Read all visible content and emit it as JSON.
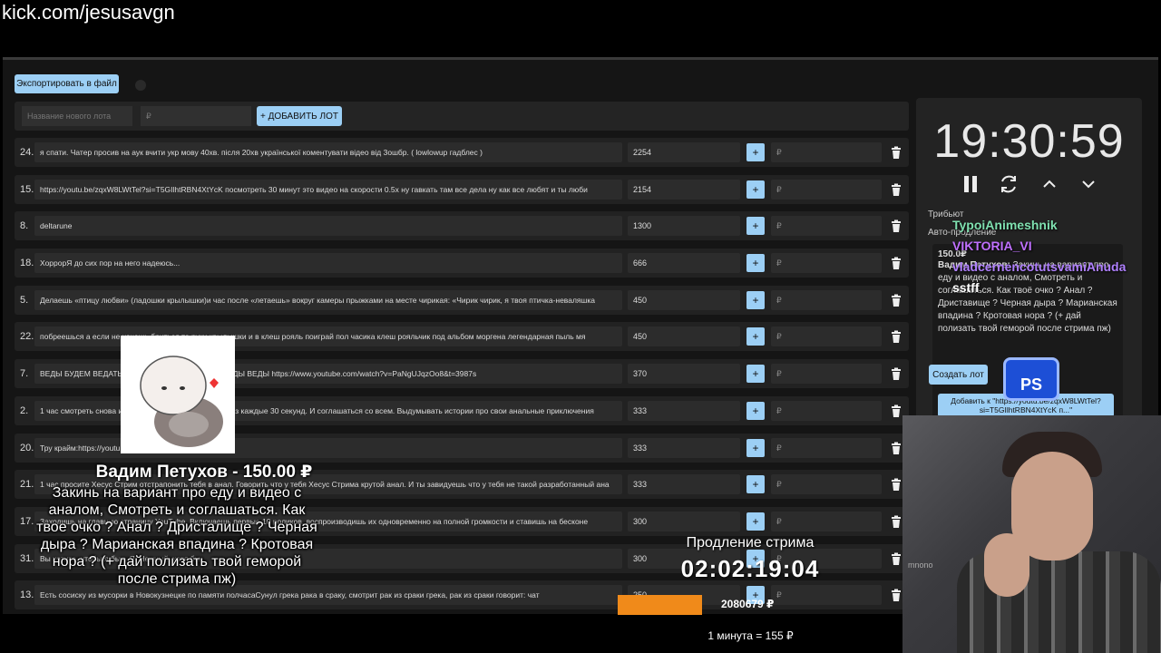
{
  "browser": {
    "url": "kick.com/jesusavgn"
  },
  "toolbar": {
    "export_label": "Экспортировать в файл"
  },
  "new_lot": {
    "name_placeholder": "Название нового лота",
    "price_placeholder": "₽",
    "add_label": "+ ДОБАВИТЬ ЛОТ"
  },
  "lots": [
    {
      "num": "24.",
      "title": "я спати. Чатер просив на аук вчити укр мову 40хв. після 20хв української коментувати відео від 3oшбр. ( lowlowup гадблес )",
      "amount": "2254",
      "add_placeholder": "₽"
    },
    {
      "num": "15.",
      "title": "https://youtu.be/zqxW8LWtTel?si=T5GIlhtRBN4XtYcK посмотреть 30 минут это видео на скорости 0.5x ну гавкать там все дела ну как все любят и ты люби",
      "amount": "2154",
      "add_placeholder": "₽"
    },
    {
      "num": "8.",
      "title": "deltarune",
      "amount": "1300",
      "add_placeholder": "₽"
    },
    {
      "num": "18.",
      "title": "ХоррорЯ до сих пор на него надеюсь...",
      "amount": "666",
      "add_placeholder": "₽"
    },
    {
      "num": "5.",
      "title": "Делаешь «птицу любви» (ладошки крылышки)и час после «летаешь» вокруг камеры прыжками на месте чирикая: «Чирик чирик, я твоя птичка-неваляшка",
      "amount": "450",
      "add_placeholder": "₽"
    },
    {
      "num": "22.",
      "title": "побреешься а если не хочешь бриться то руки крылышки и в клеш рояль поиграй пол часика клеш рояльчик под альбом моргена легендарная пыль мя",
      "amount": "450",
      "add_placeholder": "₽"
    },
    {
      "num": "7.",
      "title": "ВЕДЫ БУДЕМ ВЕДАТЬ ВЕДЫ ВЕДЫ ВЕДЫ ВЕДЫ ВЕДЫ ВЕДЫ https://www.youtube.com/watch?v=PaNgUJqzOo8&t=3987s",
      "amount": "370",
      "add_placeholder": "₽"
    },
    {
      "num": "2.",
      "title": "1 час смотреть снова и снова одно и то же видео через каждые 30 секунд. И соглашаться со всем. Выдумывать истории про свои анальные приключения",
      "amount": "333",
      "add_placeholder": "₽"
    },
    {
      "num": "20.",
      "title": "Тру крайм:https://youtu.be/3lpdC-RCiT",
      "amount": "333",
      "add_placeholder": "₽"
    },
    {
      "num": "21.",
      "title": "1 час просите Хесус Стрим отстрапонить тебя в анал. Говорить что у тебя Хесус Стрима крутой анал. И ты завидуешь что у тебя не такой разработанный ана",
      "amount": "333",
      "add_placeholder": "₽"
    },
    {
      "num": "17.",
      "title": "Заходишь на главную страницу YouTube. Включаешь первые 10 роликов, воспроизводишь их одновременно на полной громкости и ставишь на бесконе",
      "amount": "300",
      "add_placeholder": "₽"
    },
    {
      "num": "31.",
      "title": "Вы хотите, чтобы я был. Я, Нежный, хотя бы",
      "amount": "300",
      "add_placeholder": "₽"
    },
    {
      "num": "13.",
      "title": "Есть сосиску из мусорки в Новокузнецке по памяти полчасаСунул грека рака в сраку, смотрит рак из сраки грека, рак из сраки говорит: чат",
      "amount": "250",
      "add_placeholder": "₽"
    }
  ],
  "timer": {
    "display": "19:30:59"
  },
  "panel": {
    "tribute_label": "Трибьют",
    "autoext_label": "Авто-продление",
    "donation_amount": "150.0₽",
    "donation_author": "Вадим Петухов:",
    "donation_text": "Закинь на вариант про еду и видео с аналом, Смотреть и соглашаться. Как твоё очко ? Анал ? Дриставище ? Черная дыра ? Марианская впадина ? Кротовая нора ? (+ дай полизать твой геморой после стрима пж)",
    "create_lot_label": "Создать лот",
    "add_to_label": "Добавить к \"https://youtu.be/zqxW8LWtTel?si=T5GIlhtRBN4XtYcK п...\""
  },
  "chat": [
    {
      "name": "TypoiAnimeshnik",
      "color": "#7fe0b0"
    },
    {
      "name": "VIKTORIA_VI",
      "color": "#c070ff"
    },
    {
      "name": "vladcernencotutsvamiAnuda",
      "color": "#b080ff"
    },
    {
      "name": "sstff",
      "color": "#ffffff"
    }
  ],
  "overlay_badge": "PS",
  "alert": {
    "title": "Вадим Петухов - 150.00 ₽",
    "text": "Закинь на вариант про еду и видео с аналом, Смотреть и соглашаться. Как твое очко ? Анал ? Дристалище ? Черная дыра ? Марианская впадина ? Кротовая нора ? (+ дай полизать твой геморой после стрима пж)"
  },
  "extension": {
    "label": "Продление стрима",
    "timer": "02:02:19:04",
    "total": "2080679 ₽",
    "progress": 0.31,
    "rate": "1 минута = 155 ₽"
  },
  "webcam": {
    "mic_label": "mnono"
  },
  "colors": {
    "accent": "#9ccff5",
    "progress": "#f08a1a",
    "panel": "#232323"
  }
}
